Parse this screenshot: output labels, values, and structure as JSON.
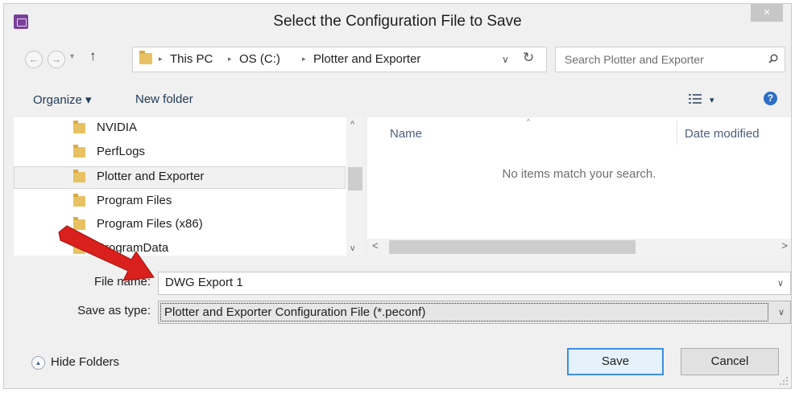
{
  "window": {
    "title": "Select the Configuration File to Save",
    "close_glyph": "×"
  },
  "nav": {
    "back_glyph": "←",
    "forward_glyph": "→",
    "recent_glyph": "▾",
    "up_glyph": "↑",
    "breadcrumb": [
      "This PC",
      "OS (C:)",
      "Plotter and Exporter"
    ],
    "breadcrumb_sep": "▸",
    "address_dropdown_glyph": "∨",
    "refresh_glyph": "↻",
    "search_placeholder": "Search Plotter and Exporter"
  },
  "toolbar": {
    "organize_label": "Organize ▾",
    "new_folder_label": "New folder",
    "view_dropdown_glyph": "▾",
    "help_glyph": "?"
  },
  "tree": {
    "items": [
      {
        "label": "NVIDIA"
      },
      {
        "label": "PerfLogs"
      },
      {
        "label": "Plotter and Exporter",
        "selected": true
      },
      {
        "label": "Program Files"
      },
      {
        "label": "Program Files (x86)"
      },
      {
        "label": "ProgramData"
      }
    ],
    "scroll_up_glyph": "^",
    "scroll_down_glyph": "v"
  },
  "files": {
    "columns": [
      "Name",
      "Date modified"
    ],
    "sort_glyph": "^",
    "empty_message": "No items match your search.",
    "scroll_left_glyph": "<",
    "scroll_right_glyph": ">"
  },
  "form": {
    "file_name_label": "File name:",
    "file_name_value": "DWG Export 1",
    "save_type_label": "Save as type:",
    "save_type_value": "Plotter and Exporter Configuration File (*.peconf)",
    "chevron_glyph": "∨"
  },
  "footer": {
    "hide_folders_label": "Hide Folders",
    "hide_folders_glyph": "▲",
    "save_label": "Save",
    "cancel_label": "Cancel"
  },
  "colors": {
    "accent_blue": "#3d8ee3",
    "annotation_arrow": "#d9201c",
    "folder_yellow": "#e8c163"
  }
}
